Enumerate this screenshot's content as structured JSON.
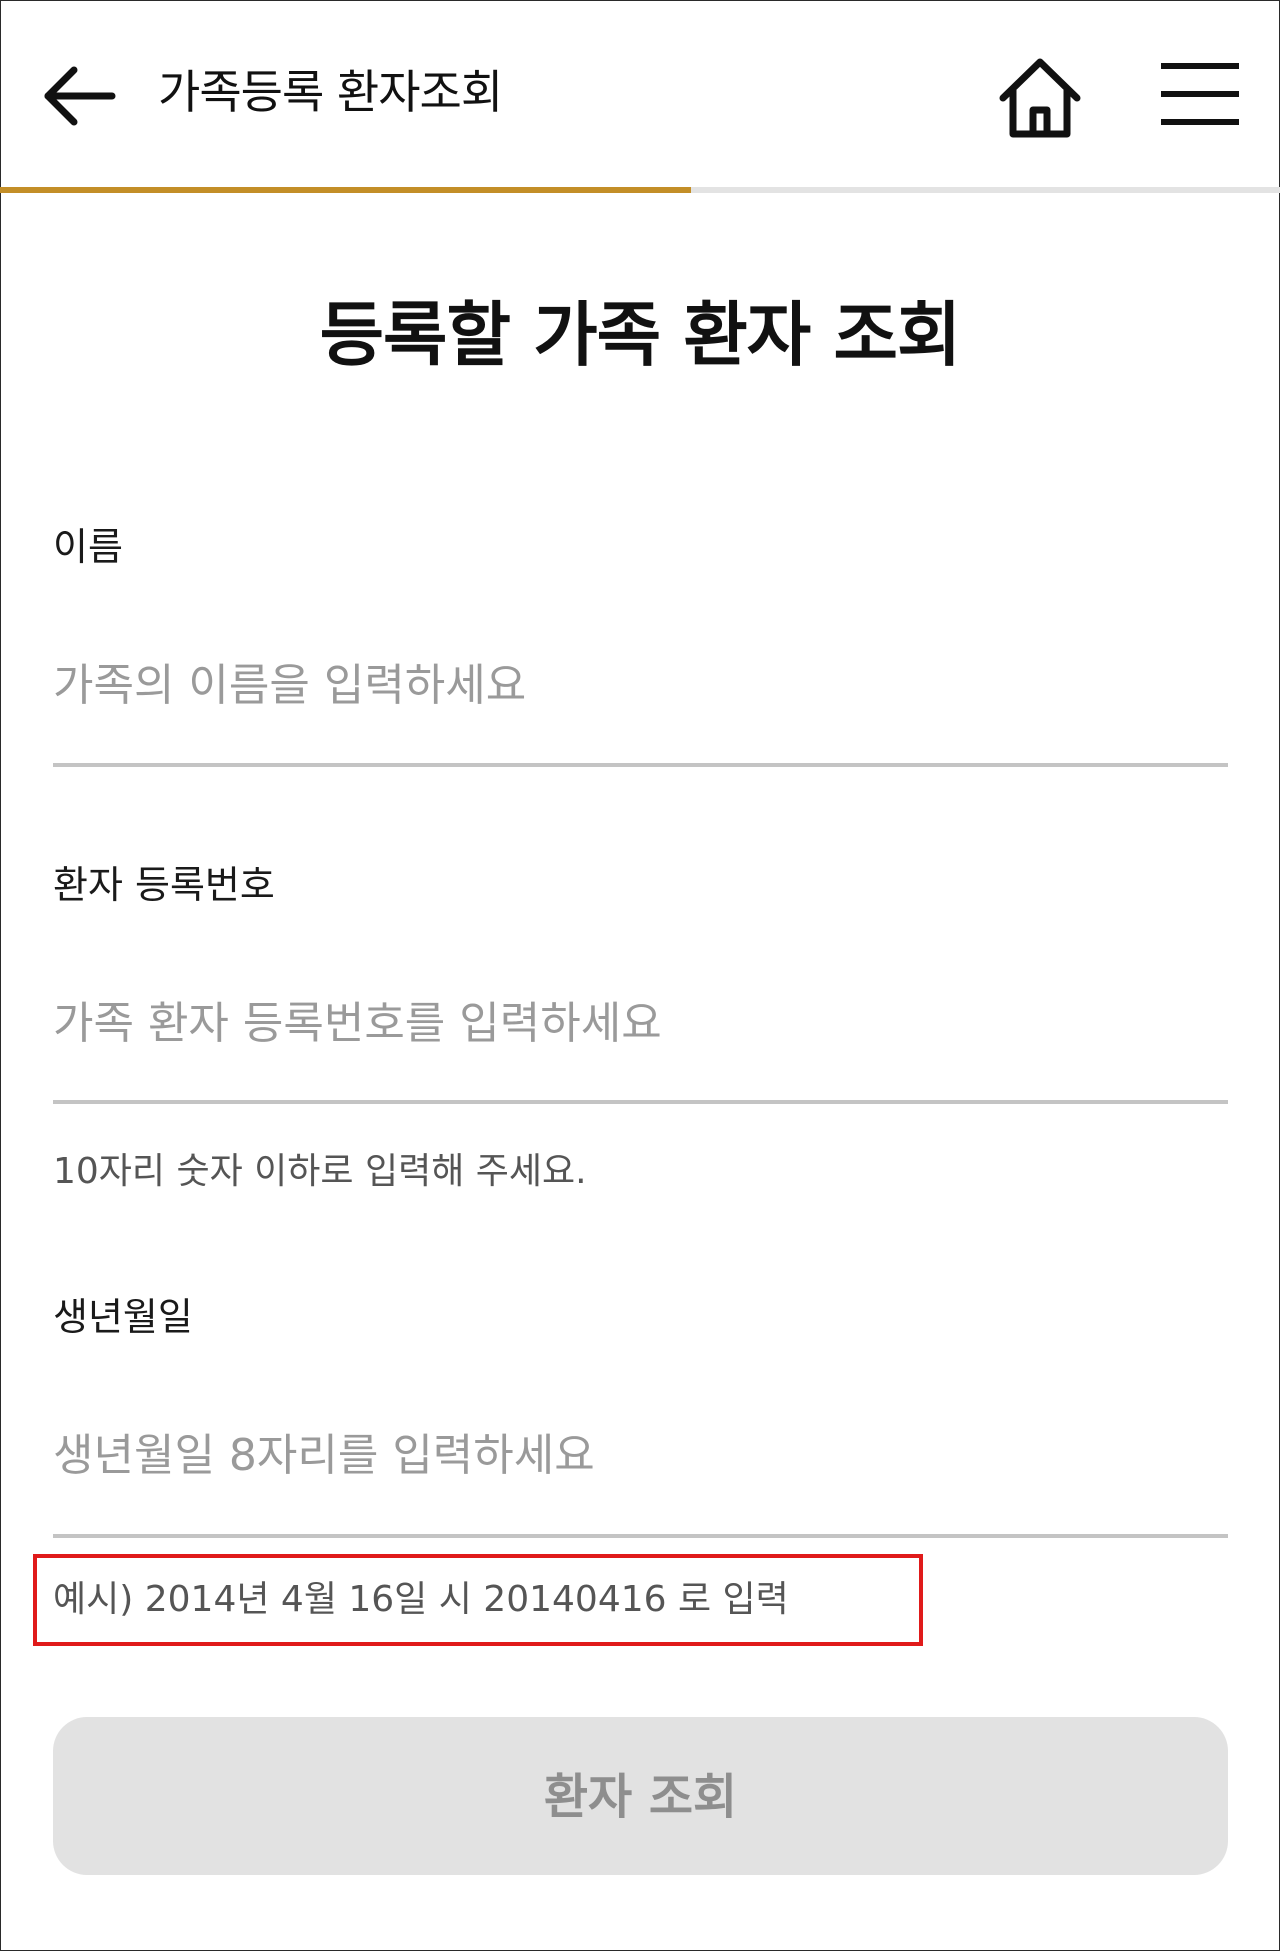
{
  "header": {
    "title": "가족등록 환자조회",
    "back_icon": "arrow-left-icon",
    "home_icon": "home-icon",
    "menu_icon": "hamburger-menu-icon"
  },
  "progress": {
    "fraction": 0.54,
    "fill_color": "#c38e27",
    "track_color": "#e3e3e3"
  },
  "page": {
    "title": "등록할 가족 환자 조회"
  },
  "form": {
    "name": {
      "label": "이름",
      "value": "",
      "placeholder": "가족의 이름을 입력하세요"
    },
    "registration": {
      "label": "환자 등록번호",
      "value": "",
      "placeholder": "가족 환자 등록번호를 입력하세요",
      "helper": "10자리 숫자 이하로 입력해 주세요."
    },
    "birthdate": {
      "label": "생년월일",
      "value": "",
      "placeholder": "생년월일 8자리를 입력하세요",
      "helper": "예시) 2014년 4월 16일 시 20140416 로 입력"
    }
  },
  "submit": {
    "label": "환자 조회"
  },
  "colors": {
    "highlight": "#e01a1a",
    "button_bg": "#e2e2e2",
    "button_text": "#8e8e8e"
  }
}
